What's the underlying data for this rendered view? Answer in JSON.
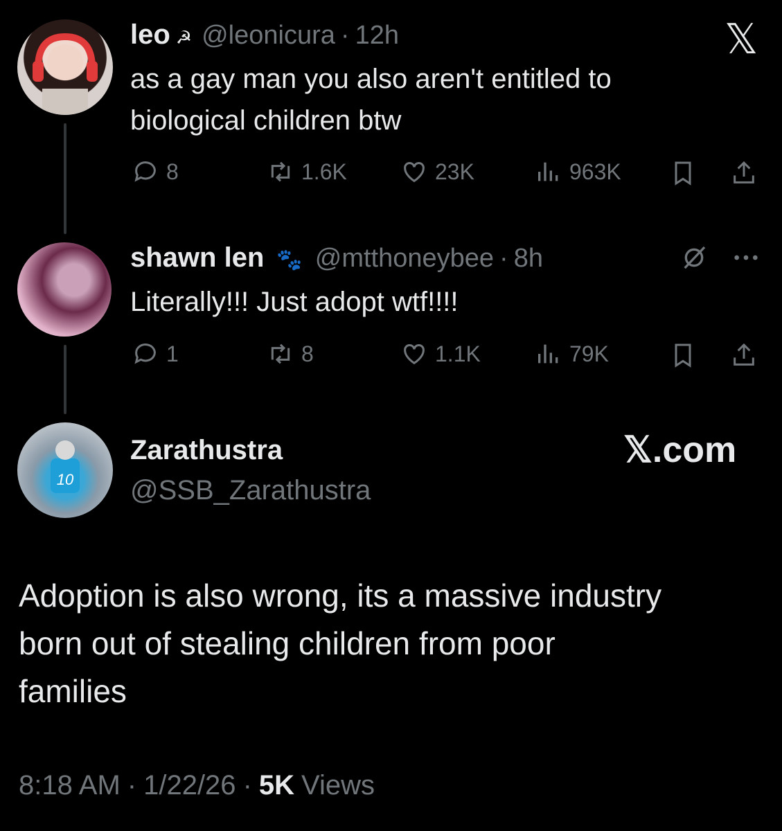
{
  "tweets": [
    {
      "display_name": "leo",
      "emoji": "☭",
      "handle": "@leonicura",
      "dot": "·",
      "time": "12h",
      "text_line1": "as a gay man you also aren't entitled to",
      "text_line2": "biological children btw",
      "replies": "8",
      "retweets": "1.6K",
      "likes": "23K",
      "views": "963K"
    },
    {
      "display_name": "shawn len",
      "emoji": "🐾",
      "handle": "@mtthoneybee",
      "dot": "·",
      "time": "8h",
      "text_line1": "Literally!!! Just adopt wtf!!!!",
      "replies": "1",
      "retweets": "8",
      "likes": "1.1K",
      "views": "79K"
    }
  ],
  "main_tweet": {
    "display_name": "Zarathustra",
    "handle": "@SSB_Zarathustra",
    "source": "𝕏.com",
    "text_line1": "Adoption is also wrong, its a massive industry",
    "text_line2": "born out of stealing children from poor",
    "text_line3": "families",
    "time": "8:18 AM",
    "dot1": "·",
    "date": "1/22/26",
    "dot2": "·",
    "views_count": "5K",
    "views_label": "Views"
  },
  "top_right_logo": "𝕏",
  "colors": {
    "background": "#000000",
    "text": "#e7e9ea",
    "muted": "#71767b"
  },
  "icons": [
    "x-logo-icon",
    "reply-icon",
    "retweet-icon",
    "like-icon",
    "views-icon",
    "bookmark-icon",
    "share-icon",
    "grok-icon",
    "more-icon"
  ]
}
